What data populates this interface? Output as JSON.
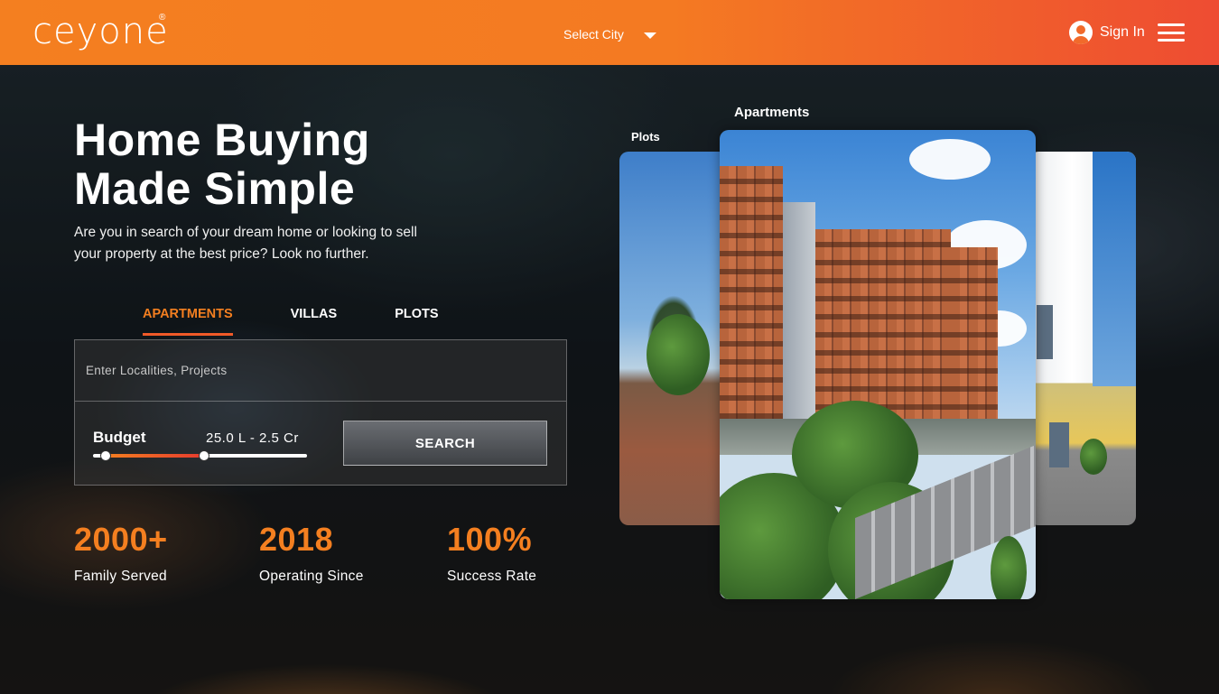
{
  "header": {
    "logo_text": "ceyone",
    "logo_mark": "®",
    "city_select": "Select City",
    "signin_label": "Sign In",
    "icons": [
      "user-circle-icon",
      "hamburger-menu-icon",
      "caret-down-icon"
    ]
  },
  "hero": {
    "title": "Home Buying Made Simple",
    "subtitle": "Are you in search of your dream home or looking to sell your property at the best price? Look no further."
  },
  "search": {
    "tabs": [
      {
        "label": "APARTMENTS",
        "active": true
      },
      {
        "label": "VILLAS",
        "active": false
      },
      {
        "label": "PLOTS",
        "active": false
      }
    ],
    "placeholder": "Enter Localities, Projects",
    "budget_label": "Budget",
    "budget_range": "25.0 L - 2.5 Cr",
    "budget_slider": {
      "low_fraction": 0.06,
      "high_fraction": 0.52
    },
    "search_button": "SEARCH"
  },
  "stats": [
    {
      "value": "2000+",
      "label": "Family Served"
    },
    {
      "value": "2018",
      "label": "Operating Since"
    },
    {
      "value": "100%",
      "label": "Success Rate"
    }
  ],
  "carousel": {
    "labels": {
      "plots": "Plots",
      "apartments": "Apartments"
    }
  },
  "colors": {
    "accent": "#f47f20",
    "header_gradient_start": "#f47f20",
    "header_gradient_end": "#ee4c32"
  }
}
